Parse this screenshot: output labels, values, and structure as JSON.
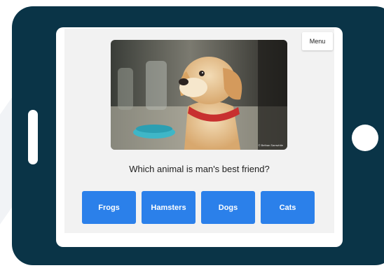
{
  "app": {
    "menu_label": "Menu",
    "photo_credit": "© Bethan Samwhite",
    "question": "Which animal is man's best friend?",
    "answers": [
      "Frogs",
      "Hamsters",
      "Dogs",
      "Cats"
    ],
    "colors": {
      "device_frame": "#0a3447",
      "answer_button": "#2b80ea",
      "screen_bg": "#f2f2f2"
    },
    "image_subject": "puppy-with-red-collar"
  }
}
